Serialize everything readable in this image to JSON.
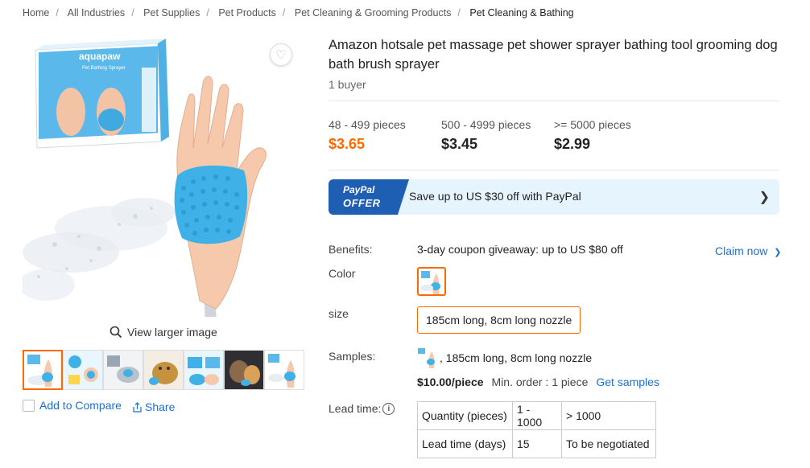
{
  "breadcrumb": [
    {
      "label": "Home"
    },
    {
      "label": "All Industries"
    },
    {
      "label": "Pet Supplies"
    },
    {
      "label": "Pet Products"
    },
    {
      "label": "Pet Cleaning & Grooming Products"
    },
    {
      "label": "Pet Cleaning & Bathing"
    }
  ],
  "gallery": {
    "view_larger": "View larger image",
    "fav_icon": "heart-icon",
    "thumb_count": 7,
    "compare_label": "Add to Compare",
    "share_label": "Share"
  },
  "product": {
    "title": "Amazon hotsale pet massage pet shower sprayer bathing tool grooming dog bath brush sprayer",
    "buyers": "1 buyer"
  },
  "pricing": {
    "tiers": [
      {
        "range": "48 - 499 pieces",
        "price": "$3.65",
        "highlight": true
      },
      {
        "range": "500 - 4999 pieces",
        "price": "$3.45",
        "highlight": false
      },
      {
        "range": ">= 5000 pieces",
        "price": "$2.99",
        "highlight": false
      }
    ],
    "accent_color": "#ff6a00"
  },
  "paypal": {
    "badge_line1": "PayPal",
    "badge_line2": "OFFER",
    "text": "Save up to US $30 off with PayPal"
  },
  "benefits": {
    "label": "Benefits:",
    "text": "3-day coupon giveaway: up to US $80 off",
    "claim": "Claim now"
  },
  "color": {
    "label": "Color"
  },
  "size": {
    "label": "size",
    "option": "185cm long, 8cm long nozzle"
  },
  "samples": {
    "label": "Samples:",
    "text": ", 185cm long, 8cm long nozzle",
    "price": "$10.00/piece",
    "min_order": "Min. order : 1 piece",
    "get_samples": "Get samples"
  },
  "lead_time": {
    "label": "Lead time:",
    "rows": [
      [
        "Quantity (pieces)",
        "1 - 1000",
        "> 1000"
      ],
      [
        "Lead time (days)",
        "15",
        "To be negotiated"
      ]
    ]
  }
}
